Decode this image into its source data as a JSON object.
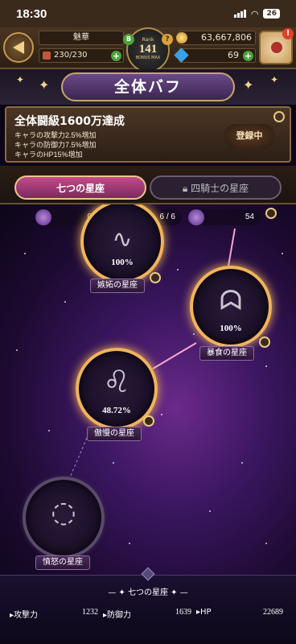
{
  "status": {
    "time": "18:30",
    "battery": "26"
  },
  "hud": {
    "player_name": "魅華",
    "stamina": "230/230",
    "rank_label": "Rank",
    "rank_value": "141",
    "rank_sub": "BONUS MAX",
    "rank_badge": "B",
    "gold": "63,667,806",
    "gems": "69"
  },
  "title": "全体バフ",
  "buff": {
    "heading": "全体闘級1600万達成",
    "lines": [
      "キャラの攻撃力2.5%増加",
      "キャラの防御力7.5%増加",
      "キャラのHP15%増加"
    ],
    "status_button": "登録中"
  },
  "tabs": [
    {
      "label": "七つの星座",
      "active": true
    },
    {
      "label": "四騎士の星座",
      "active": false,
      "locked": true
    }
  ],
  "counters": [
    {
      "icon": "constellation-icon",
      "value": "0"
    },
    {
      "icon": "tome-icon",
      "value": "6 / 6"
    },
    {
      "icon": "gp-icon",
      "value": "54"
    }
  ],
  "constellations": [
    {
      "name": "嫉妬の星座",
      "percent": "100%",
      "glyph": "serpent-icon"
    },
    {
      "name": "暴食の星座",
      "percent": "100%",
      "glyph": "wolf-icon"
    },
    {
      "name": "傲慢の星座",
      "percent": "48.72%",
      "glyph": "lion-icon"
    },
    {
      "name": "憤怒の星座",
      "percent": "",
      "glyph": "ring-icon"
    }
  ],
  "bottom": {
    "title": "七つの星座",
    "stats": [
      {
        "label": "攻撃力",
        "value": "1232"
      },
      {
        "label": "防御力",
        "value": "1639"
      },
      {
        "label": "HP",
        "value": "22689"
      }
    ]
  }
}
